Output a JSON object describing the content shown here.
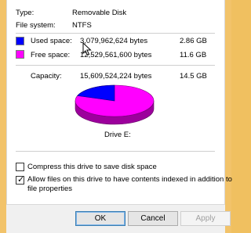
{
  "general": {
    "type_label": "Type:",
    "type_value": "Removable Disk",
    "fs_label": "File system:",
    "fs_value": "NTFS"
  },
  "space": {
    "used": {
      "label": "Used space:",
      "bytes": "3,079,962,624 bytes",
      "size": "2.86 GB",
      "color": "#0000ff"
    },
    "free": {
      "label": "Free space:",
      "bytes": "12,529,561,600 bytes",
      "size": "11.6 GB",
      "color": "#ff00ff"
    },
    "capacity": {
      "label": "Capacity:",
      "bytes": "15,609,524,224 bytes",
      "size": "14.5 GB"
    },
    "used_fraction": 0.197
  },
  "drive_label": "Drive E:",
  "options": {
    "compress": {
      "label": "Compress this drive to save disk space",
      "checked": false
    },
    "index_line1": "Allow files on this drive to have contents indexed in addition to",
    "index_line2": "file properties",
    "index_checked": true
  },
  "buttons": {
    "ok": "OK",
    "cancel": "Cancel",
    "apply": "Apply"
  }
}
